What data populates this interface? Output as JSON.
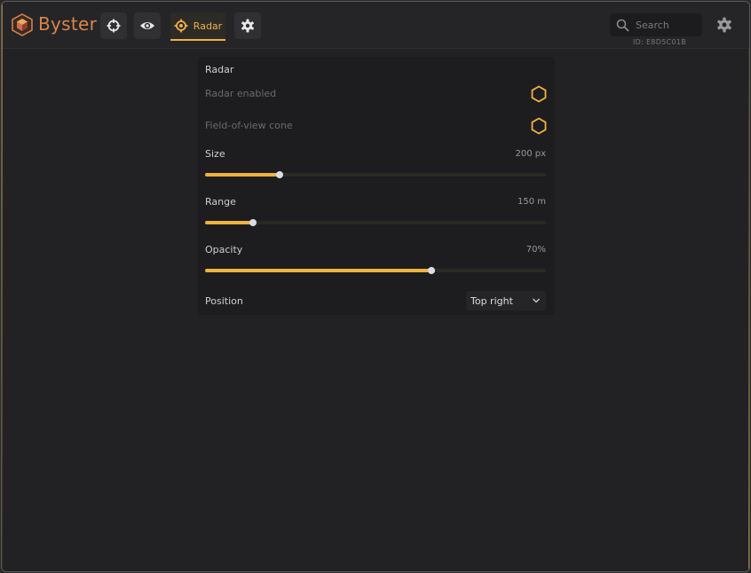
{
  "app": {
    "brand": "Byster",
    "client_id": "ID: E8D5C01B"
  },
  "nav": {
    "tabs": [
      {
        "icon": "crosshair-icon",
        "label": ""
      },
      {
        "icon": "eye-icon",
        "label": ""
      },
      {
        "icon": "radar-icon",
        "label": "Radar",
        "active": true
      },
      {
        "icon": "gear-icon",
        "label": ""
      }
    ],
    "search_placeholder": "Search"
  },
  "panel": {
    "title": "Radar",
    "radar_enabled": {
      "label": "Radar enabled",
      "enabled": false
    },
    "fov_cone": {
      "label": "Field-of-view cone",
      "enabled": false
    },
    "sliders": [
      {
        "label": "Size",
        "value_text": "200 px",
        "fraction": 0.22
      },
      {
        "label": "Range",
        "value_text": "150 m",
        "fraction": 0.14
      },
      {
        "label": "Opacity",
        "value_text": "70%",
        "fraction": 0.665
      }
    ],
    "position": {
      "label": "Position",
      "selected": "Top right"
    }
  },
  "colors": {
    "accent": "#f0b23e",
    "brand": "#d9854a",
    "background": "#222224",
    "panel": "#1d1d1f"
  }
}
